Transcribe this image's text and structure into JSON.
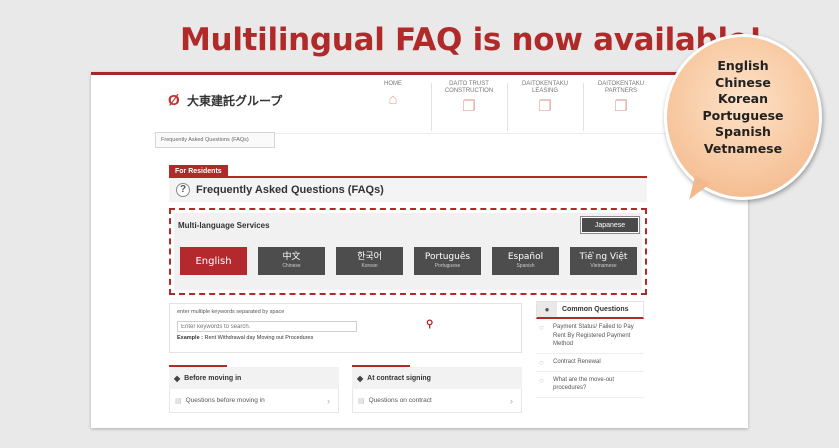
{
  "announcement": "Multilingual FAQ  is now available!",
  "brand": {
    "mark": "Ø",
    "name": "大東建託グループ"
  },
  "nav": [
    {
      "label": "HOME",
      "icon": "home-icon"
    },
    {
      "label": "DAITO TRUST\nCONSTRUCTION",
      "icon": "external-link-icon"
    },
    {
      "label": "DAITOKENTAKU\nLEASING",
      "icon": "external-link-icon"
    },
    {
      "label": "DAITOKENTAKU\nPARTNERS",
      "icon": "external-link-icon"
    }
  ],
  "breadcrumb": "Frequently Asked Questions (FAQs)",
  "residents_tab": "For Residents",
  "faq_title": "Frequently Asked Questions (FAQs)",
  "multi_language": {
    "label": "Multi-language Services",
    "japanese_button": "Japanese",
    "languages": [
      {
        "main": "English",
        "sub": "",
        "active": true
      },
      {
        "main": "中文",
        "sub": "Chinese"
      },
      {
        "main": "한국어",
        "sub": "Korean"
      },
      {
        "main": "Português",
        "sub": "Portuguese"
      },
      {
        "main": "Español",
        "sub": "Spanish"
      },
      {
        "main": "Tiê ̀ng Việt",
        "sub": "Vietnamese"
      }
    ]
  },
  "search": {
    "hint": "enter multiple keywords separated by space",
    "placeholder": "Enter keywords to search.",
    "example_label": "Example :",
    "example_text": "Rent Withdrawal day Moving out Procedures"
  },
  "categories": [
    {
      "title": "Before moving in",
      "link": "Questions before moving in"
    },
    {
      "title": "At contract signing",
      "link": "Questions on contract"
    }
  ],
  "common_questions": {
    "title": "Common Questions",
    "items": [
      "Payment Status/ Failed to Pay Rent By Registered Payment Method",
      "Contract Renewal",
      "What are the move-out procedures?"
    ]
  },
  "bubble_languages": [
    "English",
    "Chinese",
    "Korean",
    "Portuguese",
    "Spanish",
    "Vetnamese"
  ],
  "colors": {
    "accent": "#b02a2a",
    "dark_button": "#4d4d4d",
    "bubble": "#f8c9a2"
  }
}
